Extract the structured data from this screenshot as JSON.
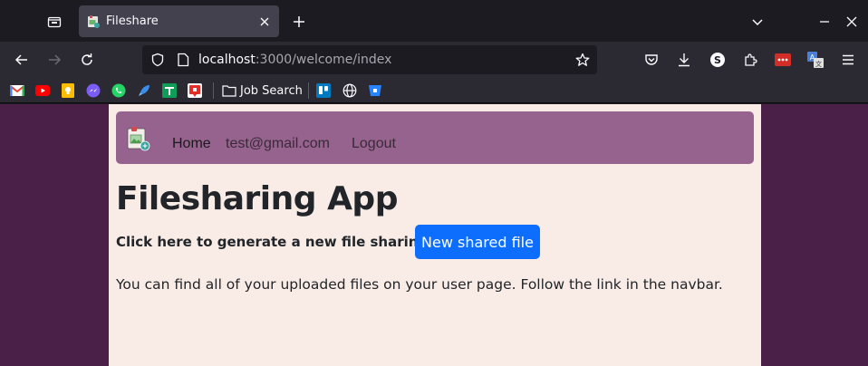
{
  "browser": {
    "tab": {
      "title": "Fileshare"
    },
    "url": {
      "host": "localhost",
      "path": ":3000/welcome/index"
    },
    "bookmarks": {
      "folder_label": "Job Search"
    }
  },
  "site": {
    "nav": {
      "home_label": "Home",
      "email_label": "test@gmail.com",
      "logout_label": "Logout"
    },
    "title": "Filesharing App",
    "generate_label": "Click here to generate a new file sharing link:",
    "new_file_button": "New shared file",
    "info_text": "You can find all of your uploaded files on your user page. Follow the link in the navbar."
  },
  "colors": {
    "page_background": "#4b2048",
    "container_background": "#f9ece7",
    "navbar_background": "#96628e",
    "primary_button": "#0d6efd"
  }
}
